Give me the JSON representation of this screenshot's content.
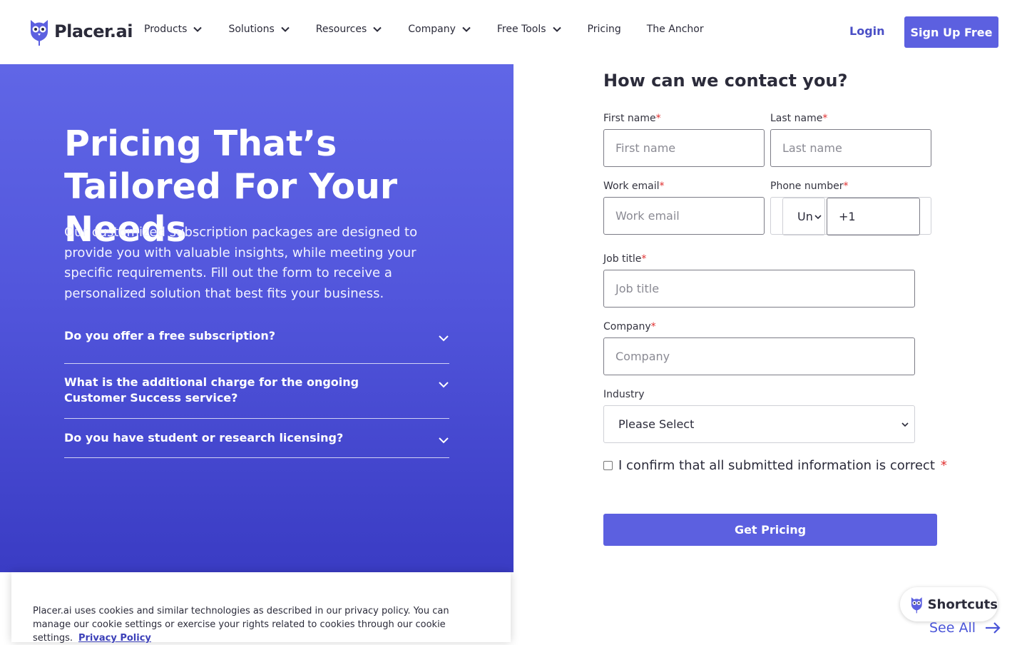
{
  "brand": {
    "name": "Placer.ai",
    "accent": "#5c60e0"
  },
  "nav": {
    "items": [
      {
        "label": "Products",
        "has_dropdown": true
      },
      {
        "label": "Solutions",
        "has_dropdown": true
      },
      {
        "label": "Resources",
        "has_dropdown": true
      },
      {
        "label": "Company",
        "has_dropdown": true
      },
      {
        "label": "Free Tools",
        "has_dropdown": true
      },
      {
        "label": "Pricing",
        "has_dropdown": false
      },
      {
        "label": "The Anchor",
        "has_dropdown": false
      }
    ],
    "login_label": "Login",
    "signup_label": "Sign Up Free"
  },
  "hero": {
    "title": "Pricing That’s Tailored For Your Needs",
    "description": "Our customized subscription packages are designed to provide you with valuable insights, while meeting your specific requirements. Fill out the form to receive a personalized solution that best fits your business.",
    "faq": [
      {
        "question": "Do you offer a free subscription?"
      },
      {
        "question": "What is the additional charge for the ongoing Customer Success service?"
      },
      {
        "question": "Do you have student or research licensing?"
      }
    ]
  },
  "form": {
    "title": "How can we contact you?",
    "first_name": {
      "label": "First name",
      "required_mark": "*",
      "placeholder": "First name"
    },
    "last_name": {
      "label": "Last name",
      "required_mark": "*",
      "placeholder": "Last name"
    },
    "work_email": {
      "label": "Work email",
      "required_mark": "*",
      "placeholder": "Work email"
    },
    "phone": {
      "label": "Phone number",
      "required_mark": "*",
      "country_value": "Un",
      "value": "+1"
    },
    "job_title": {
      "label": "Job title",
      "required_mark": "*",
      "placeholder": "Job title"
    },
    "company": {
      "label": "Company",
      "required_mark": "*",
      "placeholder": "Company"
    },
    "industry": {
      "label": "Industry",
      "selected": "Please Select"
    },
    "confirm": {
      "label": "I confirm that all submitted information is correct",
      "required_mark": "*",
      "checked": false
    },
    "submit_label": "Get Pricing"
  },
  "cookie": {
    "text": "Placer.ai uses cookies and similar technologies as described in our privacy policy. You can manage our cookie settings or exercise your rights related to cookies through our cookie settings.",
    "link_label": "Privacy Policy"
  },
  "shortcuts": {
    "label": "Shortcuts",
    "see_all_label": "See All"
  }
}
